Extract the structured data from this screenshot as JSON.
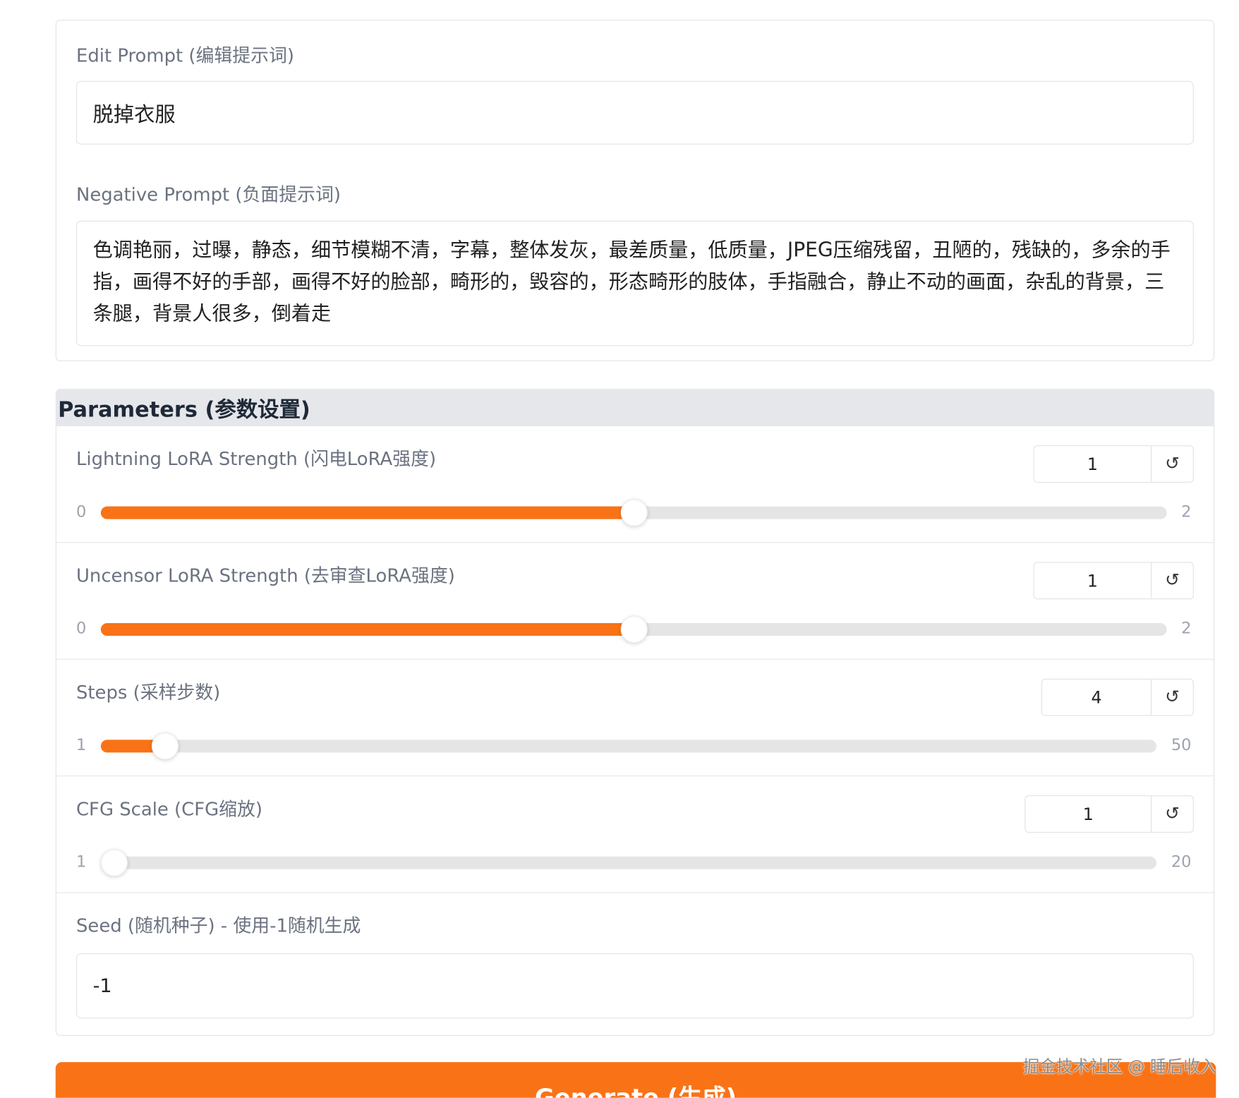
{
  "prompts": {
    "edit_label": "Edit Prompt (编辑提示词)",
    "edit_value": "脱掉衣服",
    "negative_label": "Negative Prompt (负面提示词)",
    "negative_value": "色调艳丽，过曝，静态，细节模糊不清，字幕，整体发灰，最差质量，低质量，JPEG压缩残留，丑陋的，残缺的，多余的手指，画得不好的手部，画得不好的脸部，畸形的，毁容的，形态畸形的肢体，手指融合，静止不动的画面，杂乱的背景，三条腿，背景人很多，倒着走"
  },
  "parameters": {
    "title": "Parameters (参数设置)",
    "lightning": {
      "label": "Lightning LoRA Strength (闪电LoRA强度)",
      "value": "1",
      "min": "0",
      "max": "2",
      "fraction": 0.5
    },
    "uncensor": {
      "label": "Uncensor LoRA Strength (去审查LoRA强度)",
      "value": "1",
      "min": "0",
      "max": "2",
      "fraction": 0.5
    },
    "steps": {
      "label": "Steps (采样步数)",
      "value": "4",
      "min": "1",
      "max": "50",
      "fraction": 0.0612
    },
    "cfg": {
      "label": "CFG Scale (CFG缩放)",
      "value": "1",
      "min": "1",
      "max": "20",
      "fraction": 0
    },
    "seed": {
      "label": "Seed (随机种子) - 使用-1随机生成",
      "value": "-1"
    },
    "reset_icon": "↺"
  },
  "generate_label": "Generate (生成)",
  "watermark": "掘金技术社区 @ 睡后收入",
  "colors": {
    "accent": "#f97316",
    "track": "#e5e5e5",
    "header_bg": "#e5e7eb"
  },
  "icons": {
    "reset": "reset-icon"
  }
}
